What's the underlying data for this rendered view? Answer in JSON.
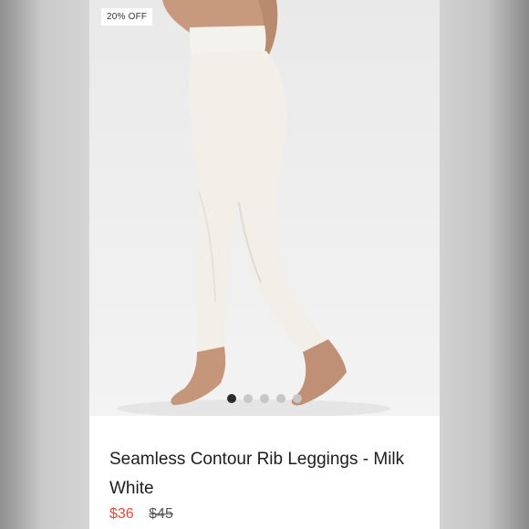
{
  "listing": {
    "badge": "20% OFF",
    "title": "Seamless Contour Rib Leggings - Milk White",
    "price_sale": "$36",
    "price_original": "$45",
    "carousel": {
      "total": 5,
      "active_index": 0
    },
    "colors": {
      "sale": "#e14b36",
      "dot_active": "#2b2b2b",
      "dot_inactive": "#c7c7c7"
    }
  }
}
